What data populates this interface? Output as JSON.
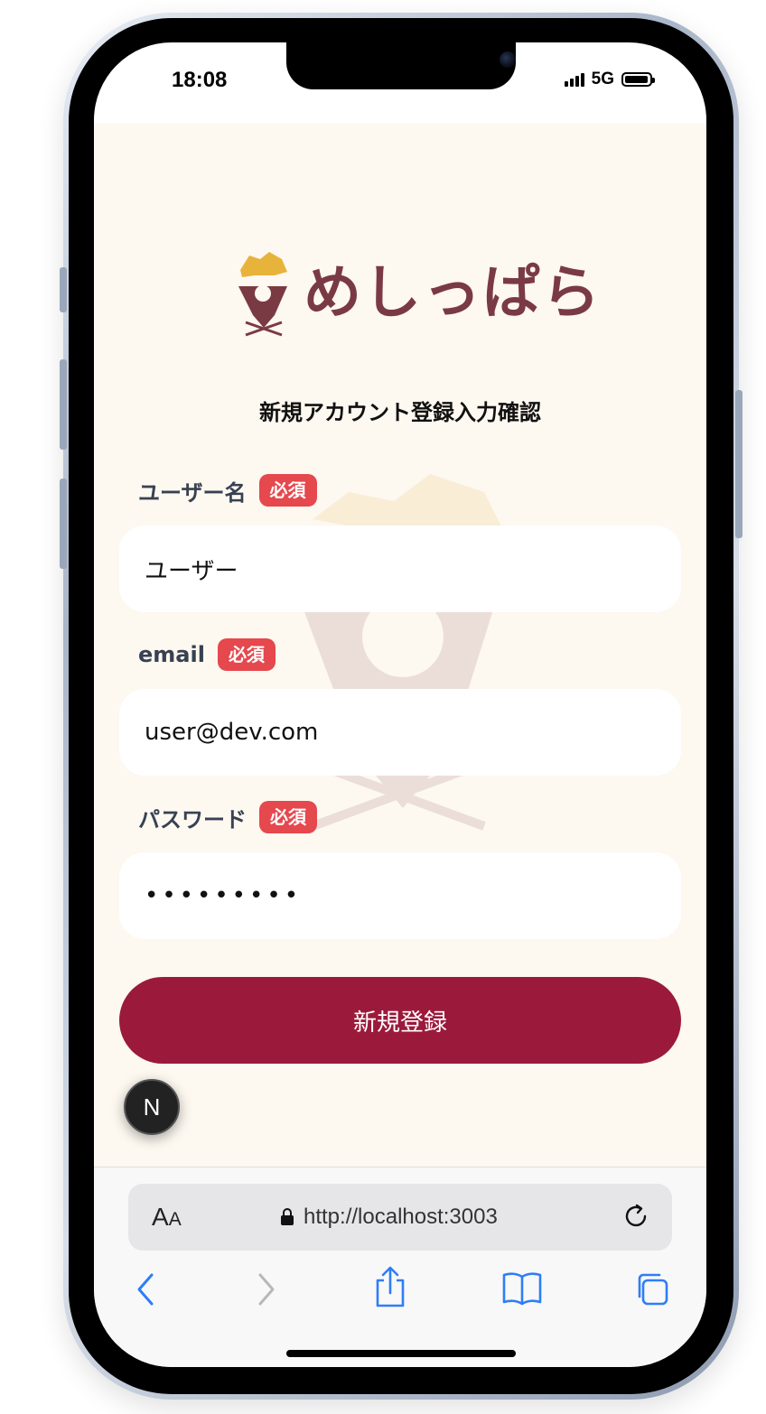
{
  "status_bar": {
    "time": "18:08",
    "network": "5G"
  },
  "app": {
    "logo_text": "めしっぱら"
  },
  "page": {
    "title": "新規アカウント登録入力確認"
  },
  "form": {
    "fields": [
      {
        "label": "ユーザー名",
        "badge": "必須",
        "value": "ユーザー"
      },
      {
        "label": "email",
        "badge": "必須",
        "value": "user@dev.com"
      },
      {
        "label": "パスワード",
        "badge": "必須",
        "value": "•••••••••"
      }
    ],
    "submit_label": "新規登録"
  },
  "dev_badge": {
    "letter": "N"
  },
  "browser": {
    "text_size_label_big": "A",
    "text_size_label_small": "A",
    "url": "http://localhost:3003"
  },
  "colors": {
    "accent": "#9b1a3b",
    "badge": "#e5484d",
    "background": "#fdf8f0",
    "logo": "#7a3a44"
  },
  "icons": [
    "lock-icon",
    "reload-icon",
    "back-icon",
    "forward-icon",
    "share-icon",
    "bookmarks-icon",
    "tabs-icon"
  ]
}
